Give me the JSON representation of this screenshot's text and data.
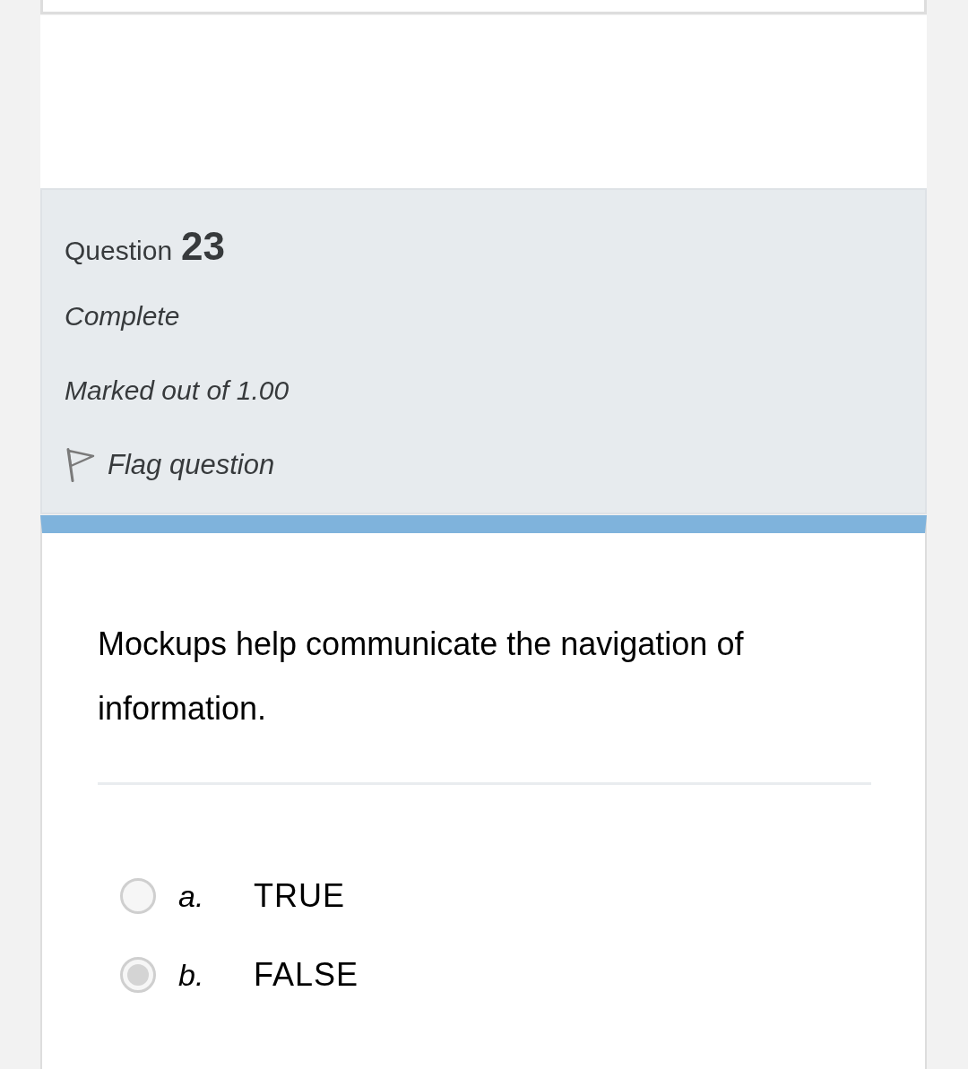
{
  "question": {
    "label": "Question",
    "number": "23",
    "status": "Complete",
    "grade": "Marked out of 1.00",
    "flag": {
      "label": "Flag question",
      "flagged": false
    }
  },
  "text": "Mockups help communicate the navigation of information.",
  "options": [
    {
      "letter": "a.",
      "text": "TRUE",
      "selected": false
    },
    {
      "letter": "b.",
      "text": "FALSE",
      "selected": true
    }
  ]
}
